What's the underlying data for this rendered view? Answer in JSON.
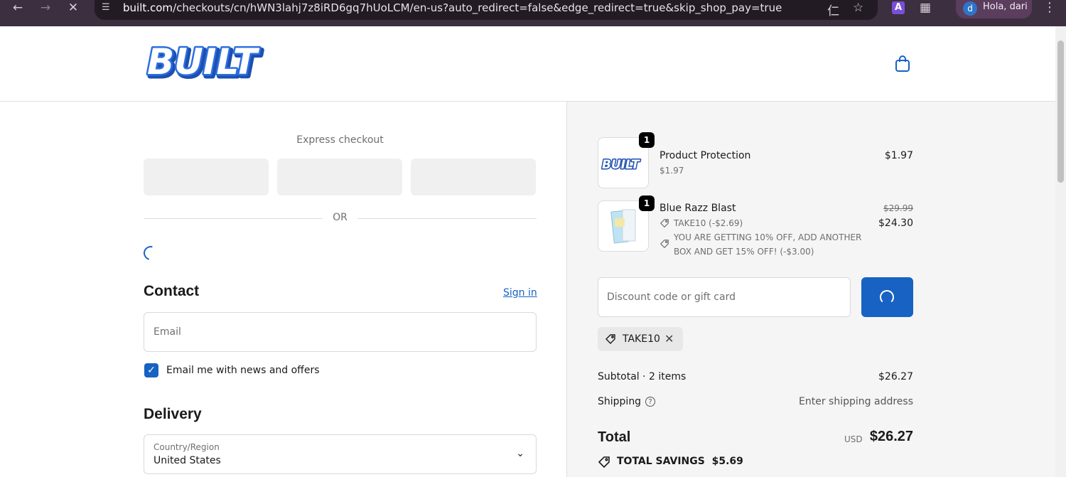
{
  "browser": {
    "url_host": "built.com",
    "url_path": "/checkouts/cn/hWN3lahj7z8iRD6gq7hUoLCM/en-us?auto_redirect=false&edge_redirect=true&skip_shop_pay=true",
    "profile_initial": "d",
    "profile_name": "Hola, dari",
    "extension_letter": "A"
  },
  "header": {
    "logo_text": "BUILT"
  },
  "express": {
    "label": "Express checkout",
    "or_label": "OR"
  },
  "contact": {
    "title": "Contact",
    "sign_in": "Sign in",
    "email_placeholder": "Email",
    "newsletter_label": "Email me with news and offers",
    "newsletter_checked": true
  },
  "delivery": {
    "title": "Delivery",
    "country_label": "Country/Region",
    "country_value": "United States"
  },
  "summary": {
    "items": [
      {
        "name": "Product Protection",
        "sub": "$1.97",
        "qty": "1",
        "price": "$1.97"
      },
      {
        "name": "Blue Razz Blast",
        "qty": "1",
        "original_price": "$29.99",
        "price": "$24.30",
        "discounts": [
          "TAKE10 (-$2.69)",
          "YOU ARE GETTING 10% OFF, ADD ANOTHER BOX AND GET 15% OFF! (-$3.00)"
        ]
      }
    ],
    "discount_placeholder": "Discount code or gift card",
    "applied_code": "TAKE10",
    "subtotal_label": "Subtotal · 2 items",
    "subtotal_value": "$26.27",
    "shipping_label": "Shipping",
    "shipping_value": "Enter shipping address",
    "total_label": "Total",
    "total_currency": "USD",
    "total_value": "$26.27",
    "savings_label": "TOTAL SAVINGS",
    "savings_value": "$5.69"
  },
  "colors": {
    "accent": "#1762c2",
    "summary_bg": "#f5f5f5",
    "chrome_bg": "#3c2f3f"
  }
}
